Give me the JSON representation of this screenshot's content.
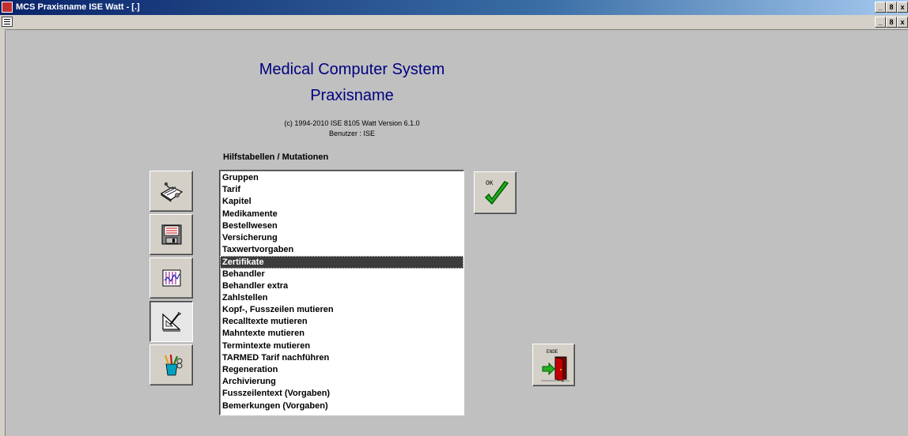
{
  "window": {
    "title": "MCS Praxisname ISE Watt - [.]",
    "controls": [
      "_",
      "8",
      "x"
    ]
  },
  "header": {
    "line1": "Medical Computer System",
    "line2": "Praxisname",
    "copyright": "(c) 1994-2010 ISE 8105 Watt  Version 6.1.0",
    "user": "Benutzer :  ISE"
  },
  "section_title": "Hilfstabellen / Mutationen",
  "list": {
    "items": [
      "Gruppen",
      "Tarif",
      "Kapitel",
      "Medikamente",
      "Bestellwesen",
      "Versicherung",
      "Taxwertvorgaben",
      "Zertifikate",
      "Behandler",
      "Behandler extra",
      "Zahlstellen",
      "Kopf-, Fusszeilen mutieren",
      "Recalltexte mutieren",
      "Mahntexte mutieren",
      "Termintexte mutieren",
      "TARMED Tarif nachführen",
      "Regeneration",
      "Archivierung",
      "Fusszeilentext (Vorgaben)",
      "Bemerkungen (Vorgaben)"
    ],
    "selected_index": 7
  },
  "buttons": {
    "ok_label": "OK",
    "exit_label": "ENDE"
  },
  "nav_icons": [
    "stethoscope-book-icon",
    "floppy-disk-icon",
    "chart-icon",
    "drafting-tools-icon",
    "pencil-cup-icon"
  ],
  "nav_active_index": 3,
  "colors": {
    "heading": "#000080",
    "selection": "#3c3c3c",
    "background": "#c0c0c0"
  }
}
